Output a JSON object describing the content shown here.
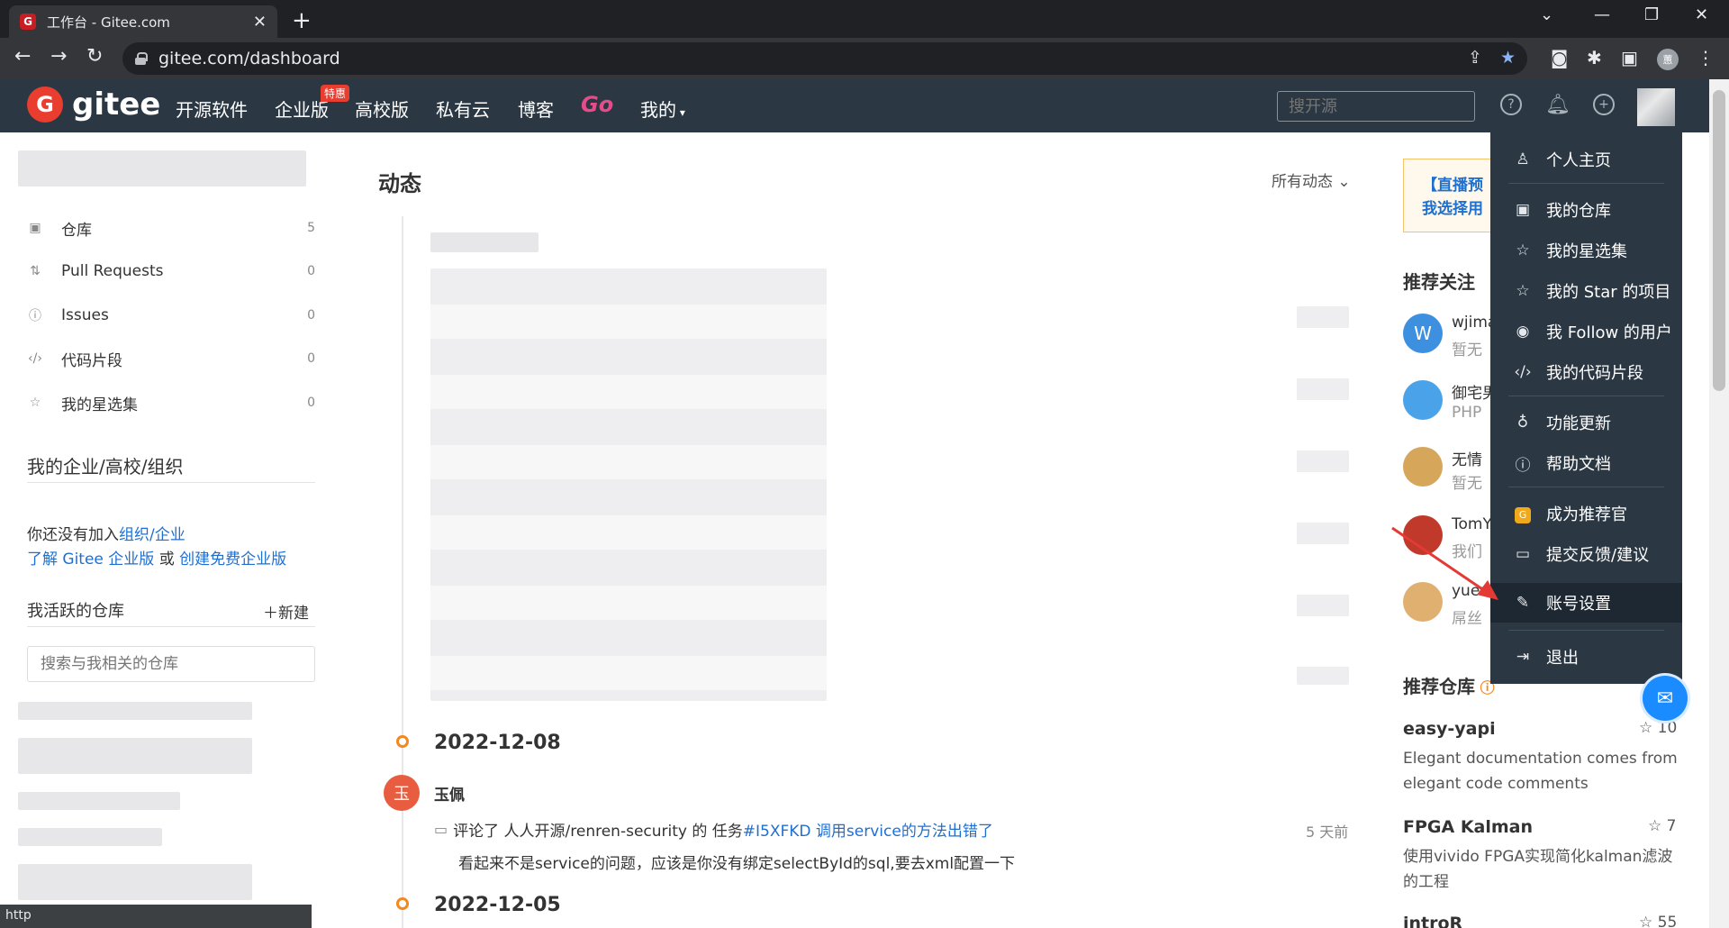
{
  "browser": {
    "tab_title": "工作台 - Gitee.com",
    "favicon_letter": "G",
    "url": "gitee.com/dashboard",
    "profile_letter": "蕙"
  },
  "header": {
    "logo_text": "gitee",
    "nav": [
      "开源软件",
      "企业版",
      "高校版",
      "私有云",
      "博客",
      "Go",
      "我的"
    ],
    "hot_badge": "特惠",
    "search_placeholder": "搜开源"
  },
  "sidebar": {
    "items": [
      {
        "label": "仓库",
        "count": "5",
        "icon": "repo-icon"
      },
      {
        "label": "Pull Requests",
        "count": "0",
        "icon": "pull-request-icon"
      },
      {
        "label": "Issues",
        "count": "0",
        "icon": "issue-icon"
      },
      {
        "label": "代码片段",
        "count": "0",
        "icon": "code-icon"
      },
      {
        "label": "我的星选集",
        "count": "0",
        "icon": "star-icon"
      }
    ],
    "org_heading": "我的企业/高校/组织",
    "org_text_prefix": "你还没有加入",
    "org_link1": "组织/企业",
    "org_link2": "了解 Gitee 企业版",
    "org_or": " 或 ",
    "org_link3": "创建免费企业版",
    "active_repos_heading": "我活跃的仓库",
    "new_label": "新建",
    "repo_search_placeholder": "搜索与我相关的仓库",
    "status_url": "http"
  },
  "feed": {
    "title": "动态",
    "filter": "所有动态",
    "entries": [
      {
        "date": "2022-12-08",
        "user_initial": "玉",
        "user_name": "玉佩",
        "action": "评论了 人人开源/renren-security 的 任务 ",
        "issue_link": "#I5XFKD 调用service的方法出错了",
        "time_ago": "5 天前",
        "comment": "看起来不是service的问题，应该是你没有绑定selectById的sql,要去xml配置一下"
      },
      {
        "date": "2022-12-05"
      }
    ]
  },
  "right": {
    "promo_line1": "【直播预",
    "promo_line2": "我选择用",
    "recommend_follow_heading": "推荐关注",
    "rec_users": [
      {
        "name": "wjima",
        "desc": "暂无",
        "avatar_text": "W",
        "color": "#3d8fe0"
      },
      {
        "name": "御宅男",
        "desc": "PHP",
        "avatar_text": "",
        "color": "#4aa3e8"
      },
      {
        "name": "无情",
        "desc": "暂无",
        "avatar_text": "",
        "color": "#d6a65a"
      },
      {
        "name": "TomY",
        "desc": "我们",
        "avatar_text": "",
        "color": "#c0392b"
      },
      {
        "name": "yuen",
        "desc": "屌丝",
        "avatar_text": "",
        "color": "#e0b070"
      }
    ],
    "recommend_repo_heading": "推荐仓库",
    "repos": [
      {
        "name": "easy-yapi",
        "stars": "10",
        "desc": "Elegant documentation comes from elegant code comments"
      },
      {
        "name": "FPGA Kalman",
        "stars": "7",
        "desc": "使用vivido FPGA实现简化kalman滤波的工程"
      },
      {
        "name": "introR",
        "stars": "55",
        "desc": ""
      }
    ]
  },
  "dropdown": {
    "items": [
      {
        "label": "个人主页",
        "icon": "user-icon"
      },
      {
        "label": "我的仓库",
        "icon": "repo-icon"
      },
      {
        "label": "我的星选集",
        "icon": "star-icon"
      },
      {
        "label": "我的 Star 的项目",
        "icon": "star-icon"
      },
      {
        "label": "我 Follow 的用户",
        "icon": "eye-icon"
      },
      {
        "label": "我的代码片段",
        "icon": "code-icon"
      },
      {
        "label": "功能更新",
        "icon": "bulb-icon"
      },
      {
        "label": "帮助文档",
        "icon": "help-icon"
      },
      {
        "label": "成为推荐官",
        "icon": "recommend-icon"
      },
      {
        "label": "提交反馈/建议",
        "icon": "feedback-icon"
      },
      {
        "label": "账号设置",
        "icon": "edit-icon"
      },
      {
        "label": "退出",
        "icon": "logout-icon"
      }
    ],
    "active_item": "账号设置"
  },
  "colors": {
    "header_bg": "#2b3844",
    "brand_red": "#c71d23",
    "link_blue": "#1f6fd0",
    "timeline_orange": "#f5871f"
  }
}
